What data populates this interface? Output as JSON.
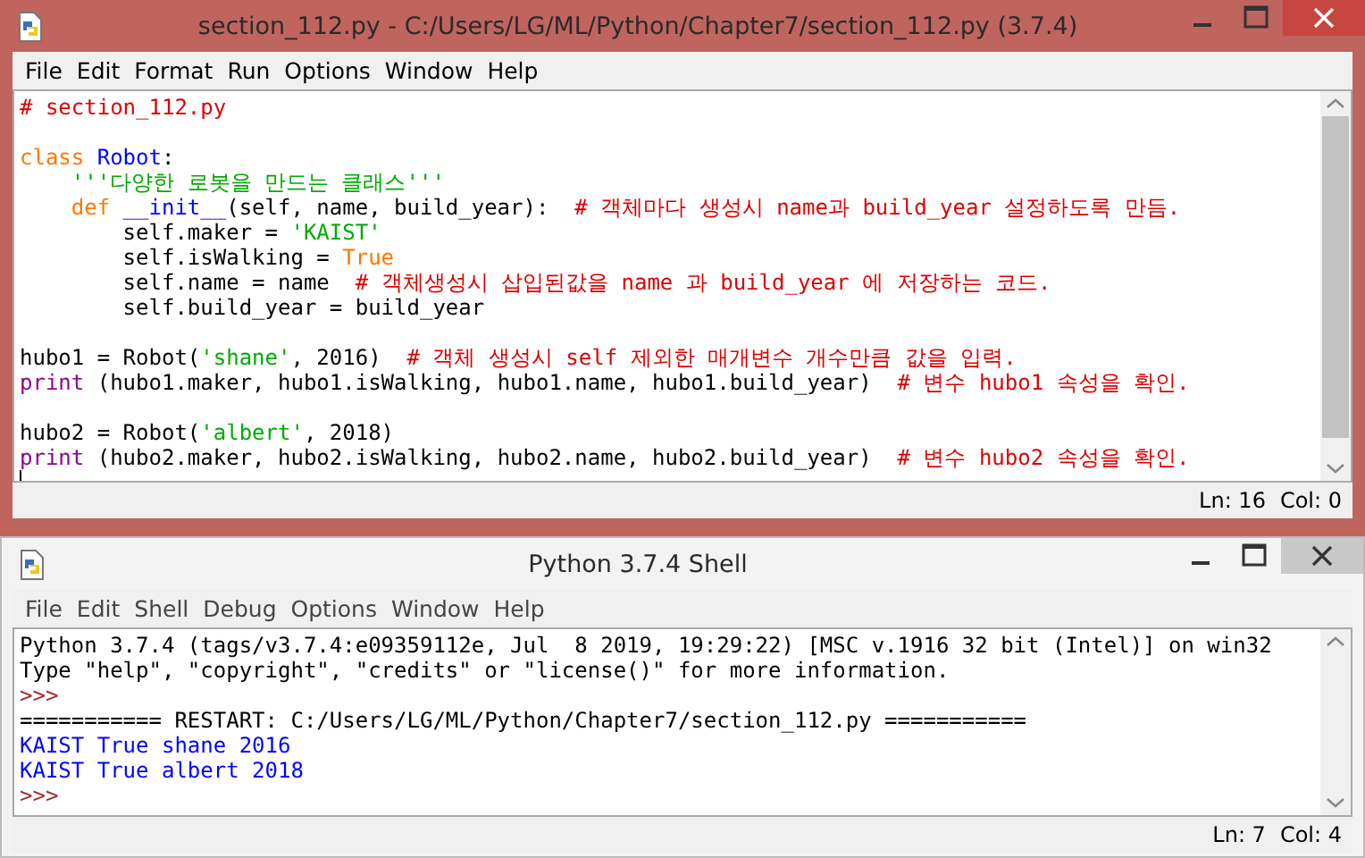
{
  "editor": {
    "title": "section_112.py - C:/Users/LG/ML/Python/Chapter7/section_112.py (3.7.4)",
    "active": true,
    "menu": [
      "File",
      "Edit",
      "Format",
      "Run",
      "Options",
      "Window",
      "Help"
    ],
    "lines": [
      {
        "kind": "code",
        "segments": [
          {
            "text": "# section_112.py",
            "kind": "comment"
          }
        ]
      },
      {
        "kind": "blank"
      },
      {
        "kind": "code",
        "segments": [
          {
            "text": "class ",
            "kind": "keyword"
          },
          {
            "text": "Robot",
            "kind": "defname"
          },
          {
            "text": ":",
            "kind": "plain"
          }
        ]
      },
      {
        "kind": "code",
        "segments": [
          {
            "text": "    '''다양한 로봇을 만드는 클래스'''",
            "kind": "string"
          }
        ]
      },
      {
        "kind": "code",
        "segments": [
          {
            "text": "    def ",
            "kind": "keyword"
          },
          {
            "text": "__init__",
            "kind": "defname"
          },
          {
            "text": "(self, name, build_year):  ",
            "kind": "plain"
          },
          {
            "text": "# 객체마다 생성시 name과 build_year 설정하도록 만듬.",
            "kind": "comment"
          }
        ]
      },
      {
        "kind": "code",
        "segments": [
          {
            "text": "        self.maker = ",
            "kind": "plain"
          },
          {
            "text": "'KAIST'",
            "kind": "string"
          }
        ]
      },
      {
        "kind": "code",
        "segments": [
          {
            "text": "        self.isWalking = ",
            "kind": "plain"
          },
          {
            "text": "True",
            "kind": "keyword"
          }
        ]
      },
      {
        "kind": "code",
        "segments": [
          {
            "text": "        self.name = name  ",
            "kind": "plain"
          },
          {
            "text": "# 객체생성시 삽입된값을 name 과 build_year 에 저장하는 코드.",
            "kind": "comment"
          }
        ]
      },
      {
        "kind": "code",
        "segments": [
          {
            "text": "        self.build_year = build_year",
            "kind": "plain"
          }
        ]
      },
      {
        "kind": "blank"
      },
      {
        "kind": "code",
        "segments": [
          {
            "text": "hubo1 = Robot(",
            "kind": "plain"
          },
          {
            "text": "'shane'",
            "kind": "string"
          },
          {
            "text": ", 2016)  ",
            "kind": "plain"
          },
          {
            "text": "# 객체 생성시 self 제외한 매개변수 개수만큼 값을 입력.",
            "kind": "comment"
          }
        ]
      },
      {
        "kind": "code",
        "segments": [
          {
            "text": "print",
            "kind": "builtin"
          },
          {
            "text": " (hubo1.maker, hubo1.isWalking, hubo1.name, hubo1.build_year)  ",
            "kind": "plain"
          },
          {
            "text": "# 변수 hubo1 속성을 확인.",
            "kind": "comment"
          }
        ]
      },
      {
        "kind": "blank"
      },
      {
        "kind": "code",
        "segments": [
          {
            "text": "hubo2 = Robot(",
            "kind": "plain"
          },
          {
            "text": "'albert'",
            "kind": "string"
          },
          {
            "text": ", 2018)",
            "kind": "plain"
          }
        ]
      },
      {
        "kind": "code",
        "segments": [
          {
            "text": "print",
            "kind": "builtin"
          },
          {
            "text": " (hubo2.maker, hubo2.isWalking, hubo2.name, hubo2.build_year)  ",
            "kind": "plain"
          },
          {
            "text": "# 변수 hubo2 속성을 확인.",
            "kind": "comment"
          }
        ]
      }
    ],
    "status": [
      "Ln: 16",
      "Col: 0"
    ]
  },
  "shell": {
    "title": "Python 3.7.4 Shell",
    "active": false,
    "menu": [
      "File",
      "Edit",
      "Shell",
      "Debug",
      "Options",
      "Window",
      "Help"
    ],
    "lines": [
      {
        "kind": "code",
        "segments": [
          {
            "text": "Python 3.7.4 (tags/v3.7.4:e09359112e, Jul  8 2019, 19:29:22) [MSC v.1916 32 bit (Intel)] on win32",
            "kind": "plain"
          }
        ]
      },
      {
        "kind": "code",
        "segments": [
          {
            "text": "Type \"help\", \"copyright\", \"credits\" or \"license()\" for more information.",
            "kind": "plain"
          }
        ]
      },
      {
        "kind": "code",
        "segments": [
          {
            "text": ">>>",
            "kind": "prompt"
          }
        ]
      },
      {
        "kind": "code",
        "segments": [
          {
            "text": "=========== RESTART: C:/Users/LG/ML/Python/Chapter7/section_112.py ===========",
            "kind": "plain"
          }
        ]
      },
      {
        "kind": "code",
        "segments": [
          {
            "text": "KAIST True shane 2016",
            "kind": "output"
          }
        ]
      },
      {
        "kind": "code",
        "segments": [
          {
            "text": "KAIST True albert 2018",
            "kind": "output"
          }
        ]
      },
      {
        "kind": "code",
        "segments": [
          {
            "text": ">>>",
            "kind": "prompt"
          }
        ]
      }
    ],
    "status": [
      "Ln: 7",
      "Col: 4"
    ]
  }
}
